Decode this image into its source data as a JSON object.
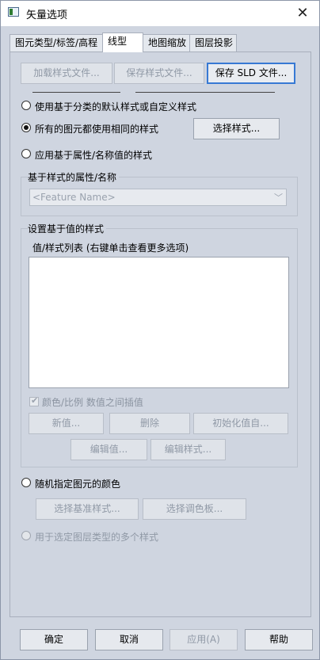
{
  "window": {
    "title": "矢量选项"
  },
  "tabs": [
    {
      "label": "图元类型/标签/高程"
    },
    {
      "label": "线型"
    },
    {
      "label": "地图缩放"
    },
    {
      "label": "图层投影"
    }
  ],
  "top_buttons": {
    "load": "加载样式文件...",
    "save": "保存样式文件...",
    "save_sld": "保存 SLD 文件..."
  },
  "options": {
    "default_style": "使用基于分类的默认样式或自定义样式",
    "same_style": "所有的图元都使用相同的样式",
    "select_style_button": "选择样式...",
    "attr_style": "应用基于属性/名称值的样式",
    "random_color": "随机指定图元的颜色",
    "multi_style": "用于选定图层类型的多个样式"
  },
  "attr_group": {
    "title": "基于样式的属性/名称",
    "combo_value": "<Feature Name>"
  },
  "value_group": {
    "title": "设置基于值的样式",
    "list_label": "值/样式列表 (右键单击查看更多选项)",
    "interpolate": "颜色/比例 数值之间插值",
    "new_value": "新值...",
    "delete": "删除",
    "init_values": "初始化值自...",
    "edit_value": "编辑值...",
    "edit_style": "编辑样式..."
  },
  "random_buttons": {
    "select_base": "选择基准样式...",
    "select_palette": "选择调色板..."
  },
  "footer": {
    "ok": "确定",
    "cancel": "取消",
    "apply": "应用(A)",
    "help": "帮助"
  }
}
